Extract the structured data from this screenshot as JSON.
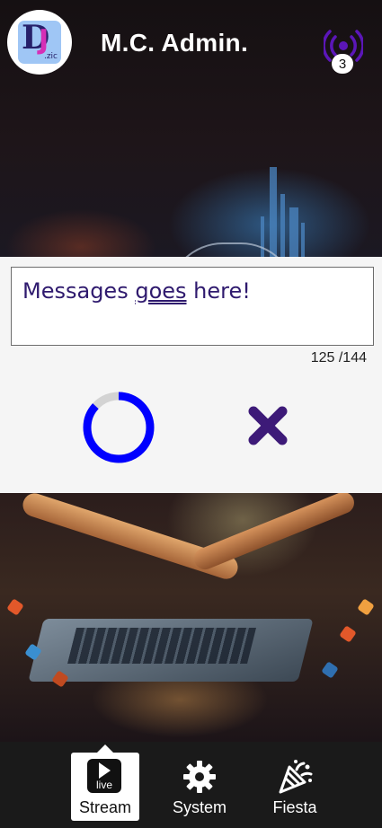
{
  "header": {
    "app_title": "M.C. Admin.",
    "logo_text": "DJ",
    "logo_suffix": ".zic",
    "broadcast_icon": "broadcast-icon",
    "listener_count": "3"
  },
  "composer": {
    "message_prefix": "Messages ",
    "message_underlined": "goes",
    "message_suffix": " here!",
    "char_count": "125",
    "char_limit": "/144",
    "progress_fraction": 0.868,
    "progress_color": "#0000ff",
    "progress_track_color": "#d3d3d3",
    "cancel_icon": "close-icon",
    "cancel_color": "#3d1a78"
  },
  "nav": {
    "items": [
      {
        "label": "Stream",
        "icon": "live-stream-icon",
        "live_text": "live",
        "active": true
      },
      {
        "label": "System",
        "icon": "gear-icon",
        "active": false
      },
      {
        "label": "Fiesta",
        "icon": "party-popper-icon",
        "active": false
      }
    ]
  }
}
